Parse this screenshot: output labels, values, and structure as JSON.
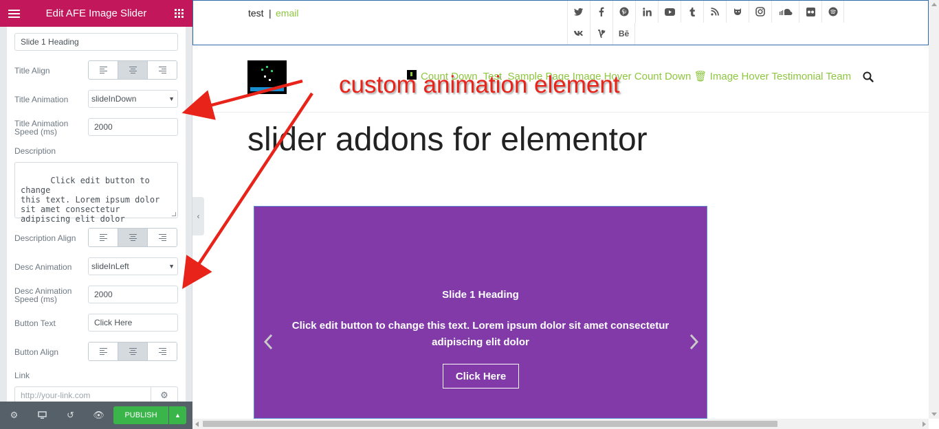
{
  "editor": {
    "title": "Edit AFE Image Slider",
    "heading_value": "Slide 1 Heading",
    "title_align_label": "Title Align",
    "title_animation_label": "Title Animation",
    "title_animation_value": "slideInDown",
    "title_anim_speed_label_1": "Title Animation",
    "title_anim_speed_label_2": "Speed (ms)",
    "title_anim_speed_value": "2000",
    "description_label": "Description",
    "description_value": "Click edit button to change\nthis text. Lorem ipsum dolor\nsit amet consectetur\nadipiscing elit dolor",
    "description_align_label": "Description Align",
    "desc_animation_label": "Desc Animation",
    "desc_animation_value": "slideInLeft",
    "desc_anim_speed_label_1": "Desc Animation",
    "desc_anim_speed_label_2": "Speed (ms)",
    "desc_anim_speed_value": "2000",
    "button_text_label": "Button Text",
    "button_text_value": "Click Here",
    "button_align_label": "Button Align",
    "link_label": "Link",
    "link_placeholder": "http://your-link.com",
    "publish_label": "PUBLISH",
    "footer_icons": [
      "gear-icon",
      "desktop-icon",
      "history-icon",
      "eye-icon"
    ]
  },
  "site": {
    "topbar_test": "test",
    "topbar_separator": "|",
    "topbar_email": "email",
    "social_row1": [
      "twitter",
      "facebook",
      "pinterest",
      "linkedin",
      "youtube",
      "tumblr",
      "rss",
      "github",
      "instagram",
      "soundcloud",
      "flickr",
      "spotify"
    ],
    "social_row2": [
      "vk",
      "vine",
      "behance"
    ],
    "behance_label": "Bē",
    "nav_items": [
      "Count Down",
      "Test",
      "Sample Page",
      "Image Hover",
      "Count Down",
      "Image Hover",
      "Testimonial",
      "Team"
    ],
    "page_title": "slider addons for elementor",
    "accent": "#8dc63f"
  },
  "slider": {
    "heading": "Slide 1 Heading",
    "description": "Click edit button to change this text. Lorem ipsum dolor sit amet consectetur adipiscing elit dolor",
    "button": "Click Here",
    "background": "#813aa8"
  },
  "annotation": {
    "text": "custom animation element",
    "color": "#e8231a"
  }
}
